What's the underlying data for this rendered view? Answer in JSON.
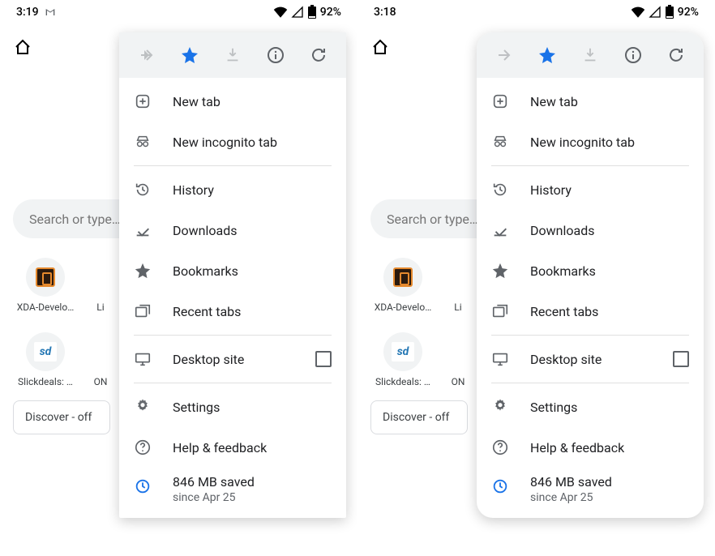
{
  "phones": [
    {
      "status": {
        "time": "3:19",
        "has_gmail_icon": true,
        "battery_pct": "92%"
      },
      "menu_style": "sharp"
    },
    {
      "status": {
        "time": "3:18",
        "has_gmail_icon": false,
        "battery_pct": "92%"
      },
      "menu_style": "rounded"
    }
  ],
  "background": {
    "search_placeholder": "Search or type…",
    "shortcuts": [
      {
        "label": "XDA-Develo…",
        "sub": "Li"
      },
      {
        "label": "Slickdeals: …",
        "sub": "ON"
      }
    ],
    "discover_label": "Discover - off"
  },
  "menu": {
    "items": {
      "new_tab": "New tab",
      "incognito": "New incognito tab",
      "history": "History",
      "downloads": "Downloads",
      "bookmarks": "Bookmarks",
      "recent_tabs": "Recent tabs",
      "desktop_site": "Desktop site",
      "settings": "Settings",
      "help": "Help & feedback",
      "saved_main": "846 MB saved",
      "saved_sub": "since Apr 25"
    }
  }
}
